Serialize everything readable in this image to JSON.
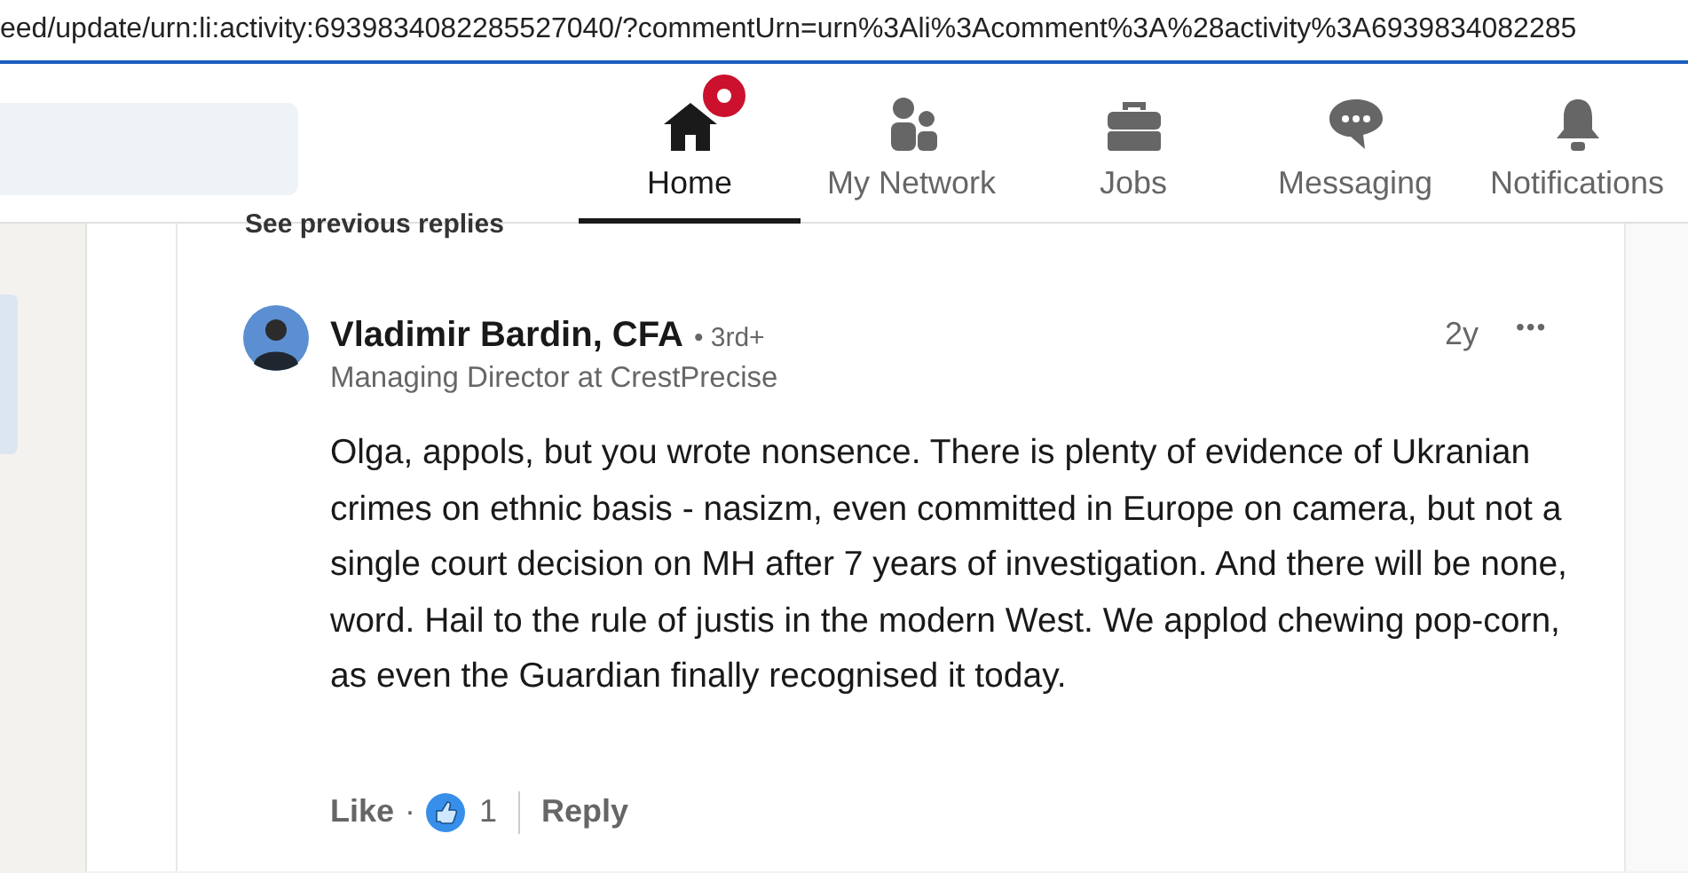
{
  "address_bar": {
    "url": "eed/update/urn:li:activity:6939834082285527040/?commentUrn=urn%3Ali%3Acomment%3A%28activity%3A6939834082285"
  },
  "nav_items": [
    {
      "kind": "home",
      "label": "Home",
      "selected": true,
      "badge": true
    },
    {
      "kind": "network",
      "label": "My Network",
      "selected": false,
      "badge": false
    },
    {
      "kind": "jobs",
      "label": "Jobs",
      "selected": false,
      "badge": false
    },
    {
      "kind": "messaging",
      "label": "Messaging",
      "selected": false,
      "badge": false
    },
    {
      "kind": "notifications",
      "label": "Notifications",
      "selected": false,
      "badge": false
    }
  ],
  "previous_replies_link": "See previous replies",
  "comment": {
    "author": "Vladimir Bardin, CFA",
    "degree": "• 3rd+",
    "headline": "Managing Director at CrestPrecise",
    "time": "2y",
    "more": "•••",
    "text": "Olga, appols, but you wrote nonsence. There is plenty of evidence of Ukranian crimes on ethnic basis - nasizm, even committed in Europe on camera, but not a single court decision on MH after 7 years of investigation. And there will be none, word. Hail to the rule of justis in the modern West. We applod chewing pop-corn, as even the Guardian finally recognised it today.",
    "like_label": "Like",
    "separator": "·",
    "reaction_count": "1",
    "reply_label": "Reply"
  }
}
